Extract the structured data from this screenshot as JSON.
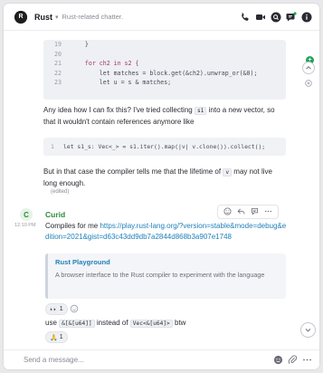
{
  "header": {
    "room_name": "Rust",
    "topic": "Rust-related chatter.",
    "logo_text": "R"
  },
  "code_top": {
    "lines": [
      {
        "num": "19",
        "text": "    }"
      },
      {
        "num": "20",
        "text": ""
      },
      {
        "num": "21",
        "text": "    for ch2 in s2 {"
      },
      {
        "num": "22",
        "text": "        let matches = block.get(&ch2).unwrap_or(&0);"
      },
      {
        "num": "23",
        "text": "        let u = s & matches;"
      }
    ]
  },
  "message1": {
    "text_before": "Any idea how I can fix this? I've tried collecting ",
    "code": "s1",
    "text_after": " into a new vector, so that it wouldn't contain references anymore like"
  },
  "code_mid": {
    "num": "1",
    "text": "let s1_s: Vec<_> = s1.iter().map(|v| v.clone()).collect();"
  },
  "message2": {
    "text_before": "But in that case the compiler tells me that the lifetime of ",
    "code": "v",
    "text_after": " may not live long enough.",
    "edited": "(edited)"
  },
  "curid": {
    "avatar": "C",
    "sender": "Curid",
    "time": "12:10 PM",
    "text": "Compiles for me ",
    "link": "https://play.rust-lang.org/?version=stable&mode=debug&edition=2021&gist=d63c43dd9db7a2844d868b3a907e1748",
    "preview_title": "Rust Playground",
    "preview_desc": "A browser interface to the Rust compiler to experiment with the language",
    "reaction1_emoji": "👀",
    "reaction1_count": "1",
    "use_prefix": "use ",
    "use_code1": "&[&[u64]]",
    "use_mid": " instead of ",
    "use_code2": "Vec<&[u64]>",
    "use_suffix": " btw",
    "reaction2_emoji": "🙏",
    "reaction2_count": "1"
  },
  "composer": {
    "placeholder": "Send a message..."
  },
  "colors": {
    "accent": "#1fa35a",
    "link": "#1f7fb8",
    "sender": "#2e8b3a"
  }
}
